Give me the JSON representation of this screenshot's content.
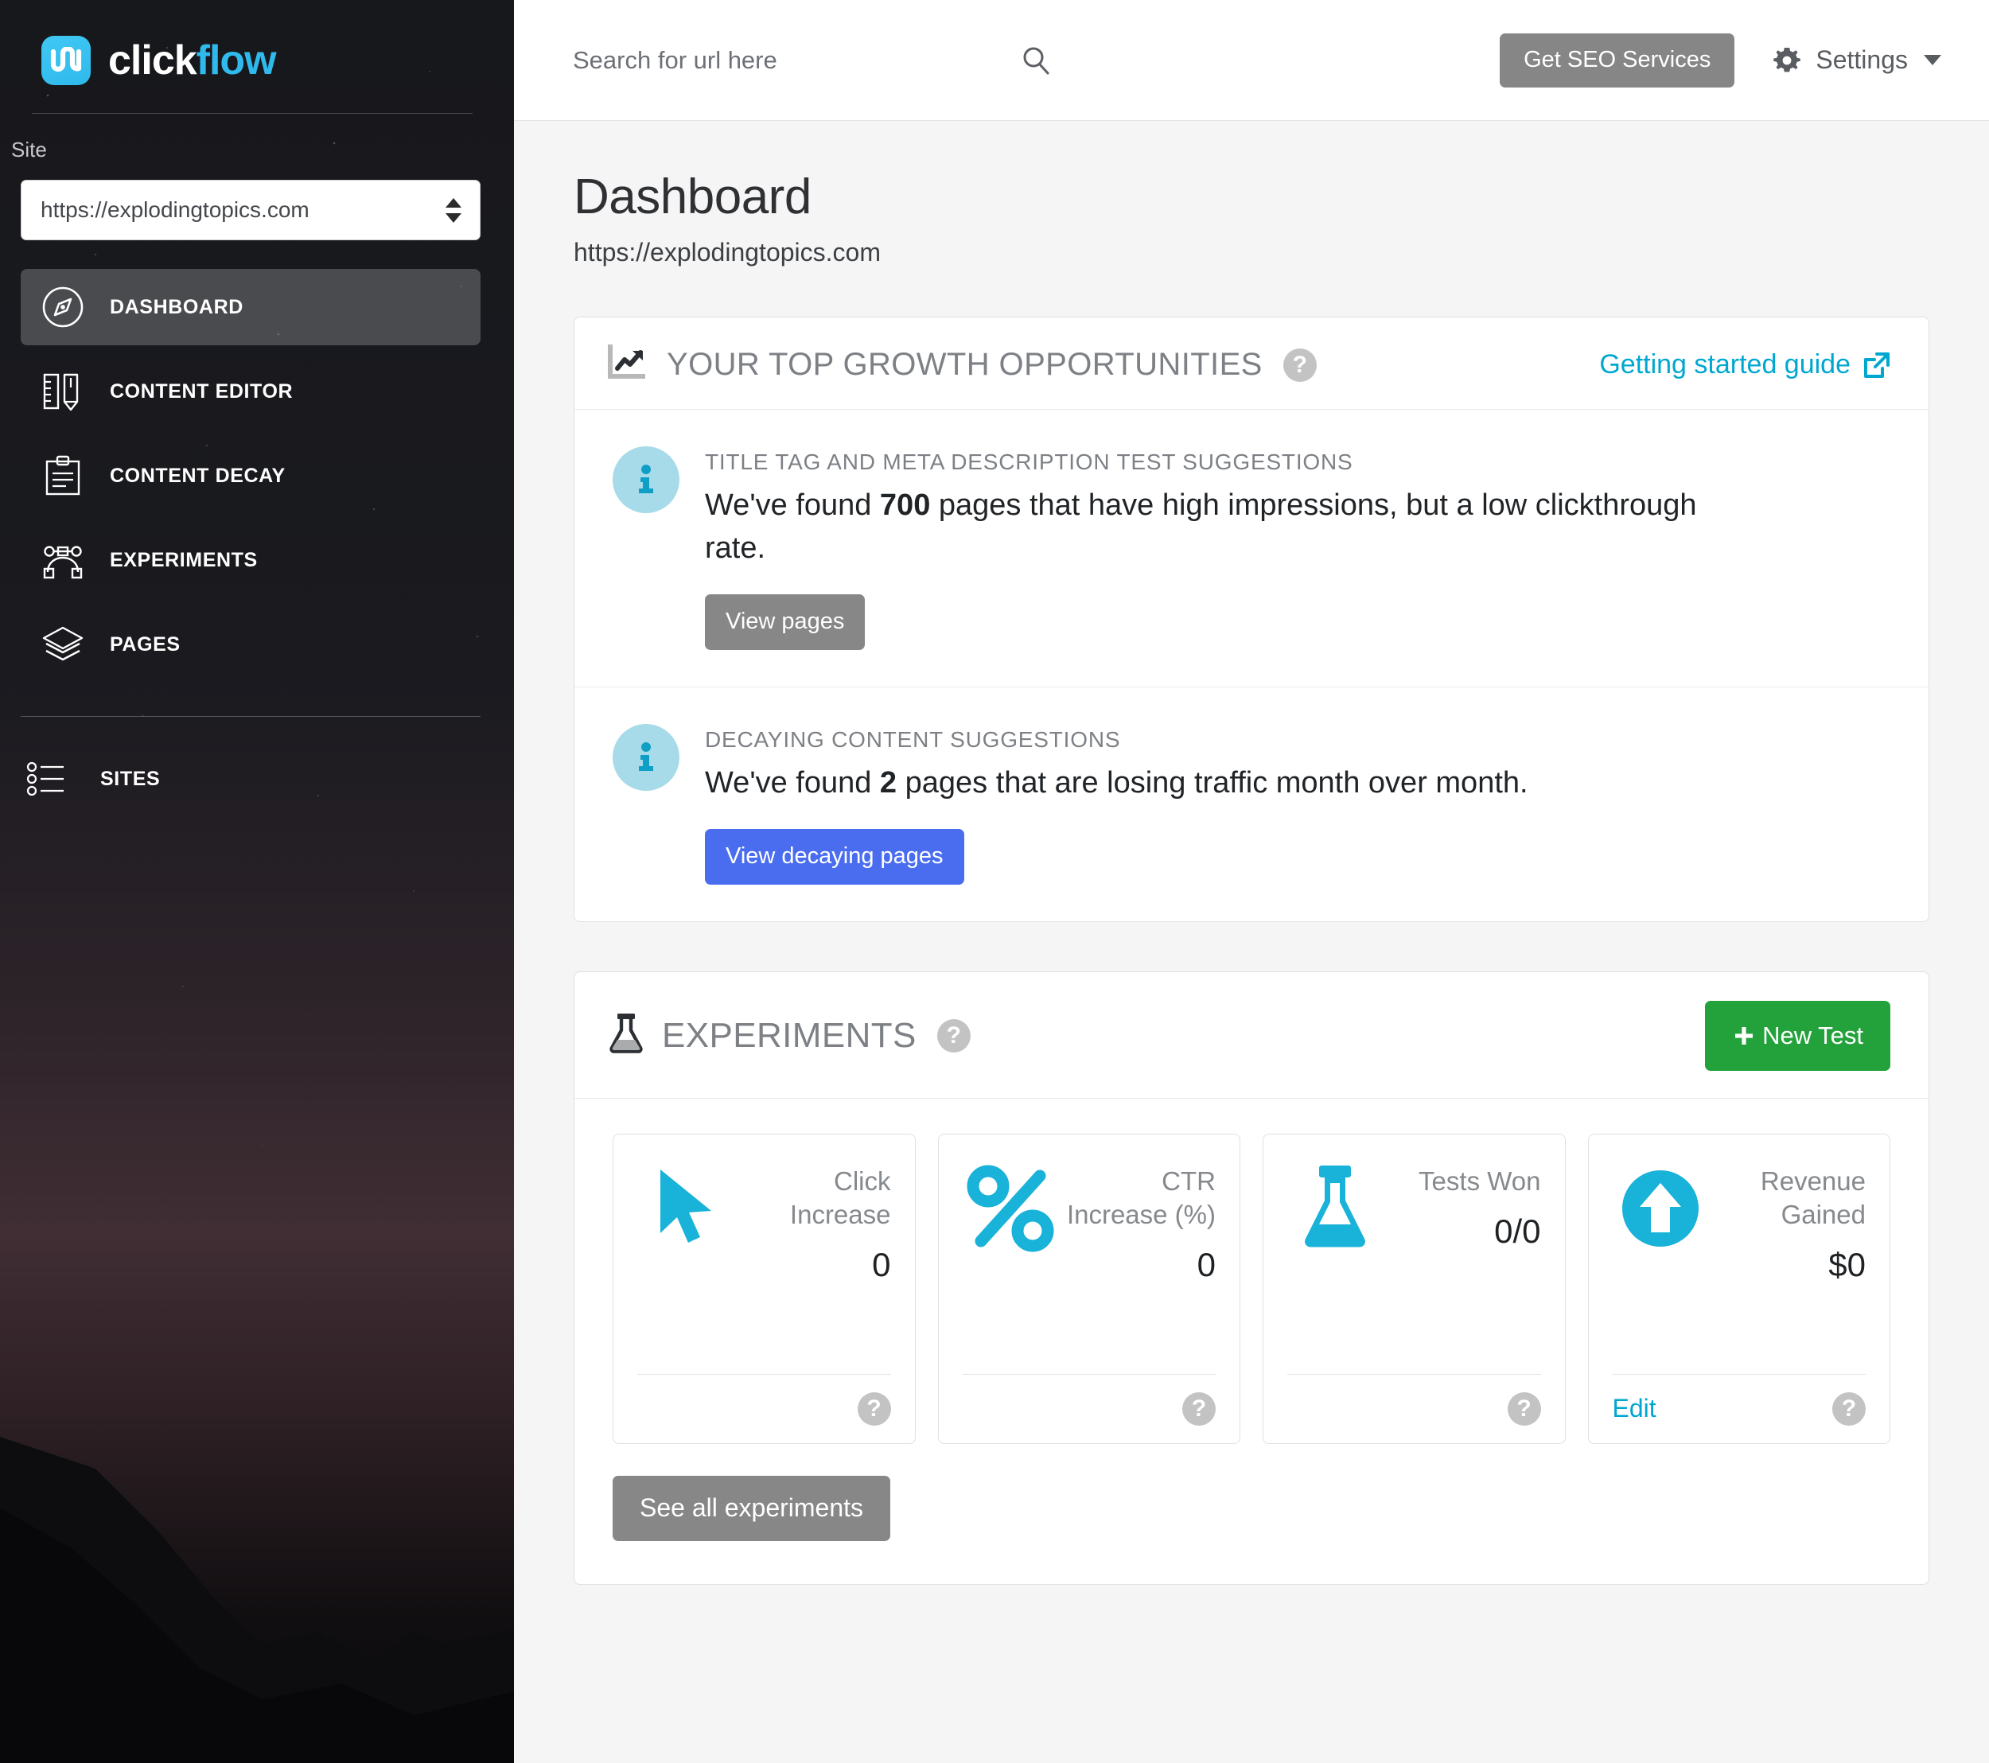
{
  "brand": {
    "name_part1": "click",
    "name_part2": "flow",
    "logo_icon": "clickflow-logo-icon"
  },
  "sidebar": {
    "site_label": "Site",
    "site_selected": "https://explodingtopics.com",
    "nav_items": [
      {
        "label": "DASHBOARD",
        "icon": "compass-icon",
        "active": true
      },
      {
        "label": "CONTENT EDITOR",
        "icon": "ruler-pencil-icon",
        "active": false
      },
      {
        "label": "CONTENT DECAY",
        "icon": "clipboard-icon",
        "active": false
      },
      {
        "label": "EXPERIMENTS",
        "icon": "node-path-icon",
        "active": false
      },
      {
        "label": "PAGES",
        "icon": "layers-icon",
        "active": false
      }
    ],
    "lower_items": [
      {
        "label": "SITES",
        "icon": "bullet-list-icon"
      }
    ]
  },
  "topbar": {
    "search_placeholder": "Search for url here",
    "search_value": "",
    "search_icon": "search-icon",
    "seo_button": "Get SEO Services",
    "settings_label": "Settings",
    "settings_icon": "gear-icon",
    "caret_icon": "chevron-down-icon"
  },
  "page": {
    "title": "Dashboard",
    "subtitle": "https://explodingtopics.com"
  },
  "growth_card": {
    "icon": "chart-line-up-icon",
    "title": "YOUR TOP GROWTH OPPORTUNITIES",
    "help": "?",
    "guide_link": "Getting started guide",
    "guide_icon": "external-link-icon",
    "suggestions": [
      {
        "icon": "info-circle-icon",
        "kicker": "TITLE TAG AND META DESCRIPTION TEST SUGGESTIONS",
        "text_before": "We've found ",
        "count": "700",
        "text_after": " pages that have high impressions, but a low clickthrough rate.",
        "button": "View pages",
        "button_style": "gray"
      },
      {
        "icon": "info-circle-icon",
        "kicker": "DECAYING CONTENT SUGGESTIONS",
        "text_before": "We've found ",
        "count": "2",
        "text_after": " pages that are losing traffic month over month.",
        "button": "View decaying pages",
        "button_style": "blue"
      }
    ]
  },
  "experiments_card": {
    "icon": "flask-icon",
    "title": "EXPERIMENTS",
    "help": "?",
    "new_test_button": "New Test",
    "new_test_icon": "plus-icon",
    "see_all_button": "See all experiments",
    "stats": [
      {
        "icon": "cursor-arrow-icon",
        "label": "Click Increase",
        "value": "0",
        "help": "?",
        "edit": ""
      },
      {
        "icon": "percent-icon",
        "label": "CTR Increase (%)",
        "value": "0",
        "help": "?",
        "edit": ""
      },
      {
        "icon": "flask-icon",
        "label": "Tests Won",
        "value": "0/0",
        "help": "?",
        "edit": ""
      },
      {
        "icon": "arrow-up-circle-icon",
        "label": "Revenue Gained",
        "value": "$0",
        "help": "?",
        "edit": "Edit"
      }
    ]
  },
  "colors": {
    "accent_cyan": "#00a7d0",
    "logo_cyan": "#2fb9ec",
    "blue_button": "#4a6df0",
    "green_button": "#23a23c",
    "gray_button": "#878787",
    "info_badge_bg": "#a7dbe9",
    "help_dot": "#c3c3c3",
    "sidebar_dark": "#17181c",
    "page_bg": "#f5f5f5"
  }
}
